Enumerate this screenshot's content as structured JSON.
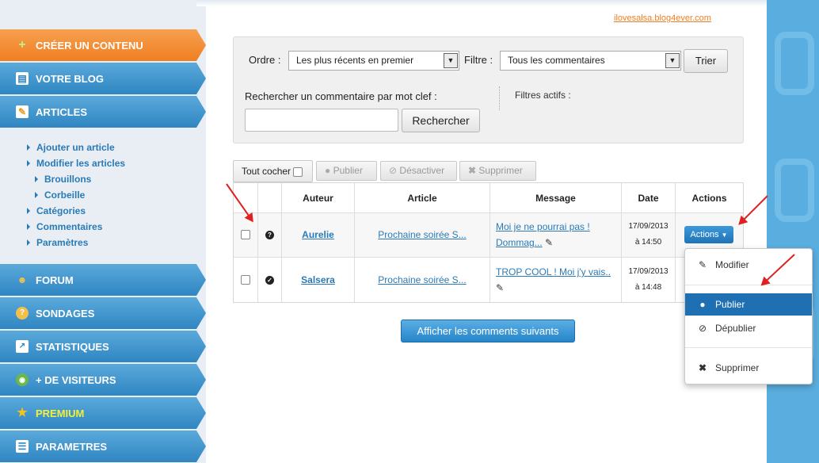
{
  "sidebar": {
    "items": [
      {
        "label": "CRÉER UN CONTENU",
        "icon": "plus-icon",
        "color": "#ef7f22"
      },
      {
        "label": "VOTRE BLOG",
        "icon": "blog-icon"
      },
      {
        "label": "ARTICLES",
        "icon": "article-icon"
      },
      {
        "label": "FORUM",
        "icon": "forum-icon"
      },
      {
        "label": "SONDAGES",
        "icon": "poll-icon"
      },
      {
        "label": "STATISTIQUES",
        "icon": "stats-icon"
      },
      {
        "label": "+ DE VISITEURS",
        "icon": "globe-icon"
      },
      {
        "label": "PREMIUM",
        "icon": "star-icon",
        "color": "#f2f03a"
      },
      {
        "label": "PARAMETRES",
        "icon": "settings-icon"
      }
    ],
    "submenu": [
      {
        "label": "Ajouter un article"
      },
      {
        "label": "Modifier les articles"
      },
      {
        "label": "Brouillons"
      },
      {
        "label": "Corbeille"
      },
      {
        "label": "Catégories"
      },
      {
        "label": "Commentaires"
      },
      {
        "label": "Paramètres"
      }
    ]
  },
  "header": {
    "blog_link": "ilovesalsa.blog4ever.com"
  },
  "filters": {
    "order_label": "Ordre :",
    "order_value": "Les plus récents en premier",
    "filter_label": "Filtre :",
    "filter_value": "Tous les commentaires",
    "sort_button": "Trier",
    "search_label": "Rechercher un commentaire par mot clef :",
    "search_value": "",
    "search_button": "Rechercher",
    "active_filters_label": "Filtres actifs :"
  },
  "toolbar": {
    "select_all": "Tout cocher",
    "publish": "Publier",
    "deactivate": "Désactiver",
    "delete": "Supprimer"
  },
  "table": {
    "columns": [
      "Auteur",
      "Article",
      "Message",
      "Date",
      "Actions"
    ],
    "rows": [
      {
        "status": "pending",
        "author": "Aurelie",
        "article": "Prochaine soirée S...",
        "message_1": "Moi je ne pourrai pas !",
        "message_2": "Dommag...",
        "date": "17/09/2013",
        "time": "à 14:50"
      },
      {
        "status": "published",
        "author": "Salsera",
        "article": "Prochaine soirée S...",
        "message_1": "TROP COOL ! Moi j'y vais..",
        "message_2": "",
        "date": "17/09/2013",
        "time": "à 14:48"
      }
    ],
    "actions_button": "Actions"
  },
  "actions_menu": {
    "items": [
      {
        "label": "Modifier",
        "icon": "pencil-icon"
      },
      {
        "label": "Publier",
        "icon": "check-circle-icon",
        "selected": true
      },
      {
        "label": "Dépublier",
        "icon": "ban-icon"
      },
      {
        "label": "Supprimer",
        "icon": "x-icon"
      }
    ]
  },
  "more_button": "Afficher les comments suivants",
  "colors": {
    "accent": "#2a7ab7",
    "orange": "#ef7f22",
    "annotation": "#e02020"
  }
}
